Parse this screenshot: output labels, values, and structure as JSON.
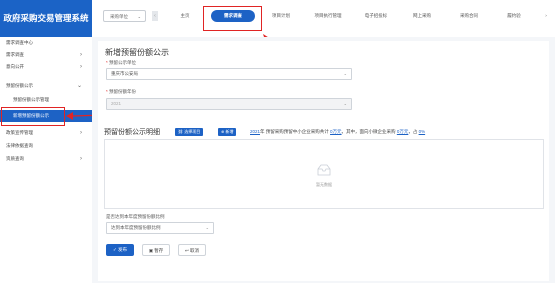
{
  "header": {
    "app_title": "政府采购交易管理系统",
    "unit_select": "采购单位",
    "tabs": [
      {
        "label": "主页"
      },
      {
        "label": "需求调查"
      },
      {
        "label": "项目计划"
      },
      {
        "label": "项目执行管理"
      },
      {
        "label": "电子招投标"
      },
      {
        "label": "网上采购"
      },
      {
        "label": "采购合同"
      },
      {
        "label": "履约验"
      }
    ]
  },
  "sidebar": {
    "items": [
      {
        "label": "需求调查中心"
      },
      {
        "label": "需求调查"
      },
      {
        "label": "意向公开"
      },
      {
        "label": "预留份额公示"
      },
      {
        "label": "预留份额公示管理"
      },
      {
        "label": "新增预留份额公示"
      },
      {
        "label": "政策宣传管理"
      },
      {
        "label": "法律依据查询"
      },
      {
        "label": "资质查询"
      }
    ]
  },
  "form": {
    "title": "新增预留份额公示",
    "unit_label": "预留公示单位",
    "unit_value": "重庆市公安局",
    "year_label": "预留份额年份",
    "year_value": "2021",
    "detail_title": "预留份额公示明细",
    "select_project_btn": "选择项目",
    "add_btn": "新增",
    "summary": {
      "year": "2021",
      "text1": "年 预留采购预留中小企业采购共计",
      "amount1": "0万元",
      "text2": "，其中，面向小微企业采购",
      "amount2": "0万元",
      "text3": "，占",
      "percent": "0%"
    },
    "empty_text": "暂无数据",
    "bottom_label": "是否达到本年度预留份额比例",
    "bottom_select": "达到本年度预留份额比例",
    "buttons": {
      "publish": "发布",
      "save": "暂存",
      "cancel": "取消"
    }
  },
  "colors": {
    "brand": "#1d62c5",
    "highlight": "#e02424"
  }
}
